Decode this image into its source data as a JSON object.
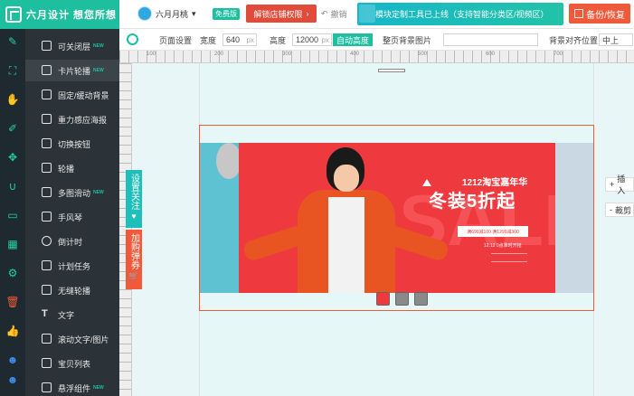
{
  "header": {
    "logo_text": "六月设计 想您所想",
    "username": "六月月桃",
    "free_badge": "免费版",
    "unlock_label": "解锁店铺权限",
    "undo_label": "撤销",
    "announcement": "模块定制工具已上线（支持智能分类区/视频区）",
    "backup_label": "备份/恢复"
  },
  "iconbar": {
    "icons": [
      "edit-icon",
      "crop-icon",
      "hand-icon",
      "pen-icon",
      "layout-icon",
      "magnet-icon",
      "ruler-icon",
      "grid-icon",
      "gear-icon",
      "trash-icon",
      "like-icon",
      "face-icon",
      "face-icon"
    ]
  },
  "sidemenu": {
    "items": [
      {
        "label": "可关闭层",
        "new": "NEW"
      },
      {
        "label": "卡片轮播",
        "new": "NEW"
      },
      {
        "label": "固定/缓动背景",
        "new": ""
      },
      {
        "label": "重力感应海报",
        "new": ""
      },
      {
        "label": "切换按钮",
        "new": ""
      },
      {
        "label": "轮播",
        "new": ""
      },
      {
        "label": "多图滑动",
        "new": "NEW"
      },
      {
        "label": "手风琴",
        "new": ""
      },
      {
        "label": "倒计时",
        "new": ""
      },
      {
        "label": "计划任务",
        "new": ""
      },
      {
        "label": "无缝轮播",
        "new": ""
      },
      {
        "label": "文字",
        "new": ""
      },
      {
        "label": "滚动文字/图片",
        "new": ""
      },
      {
        "label": "宝贝列表",
        "new": ""
      },
      {
        "label": "悬浮组件",
        "new": "NEW"
      }
    ],
    "text_icon": "T"
  },
  "toolbar": {
    "page_settings": "页面设置",
    "width_label": "宽度",
    "width_value": "640",
    "width_unit": "px",
    "height_label": "高度",
    "height_value": "12000",
    "height_unit": "px",
    "auto_height": "自动高度",
    "bg_image_label": "整页背景图片",
    "bg_align_label": "背景对齐位置",
    "bg_align_value": "中上"
  },
  "ruler": {
    "ticks": [
      "100",
      "200",
      "300",
      "400",
      "500",
      "600",
      "700"
    ]
  },
  "canvas": {
    "slide": {
      "event": "1212淘宝嘉年华",
      "headline": "冬装5折起",
      "coupon": "满699减100 满1299减300",
      "date": "12.12 0点准时开抢",
      "shirt_text": "HEART LIKE TAINI",
      "ghost_letter": "SALE"
    },
    "dots_count": 3,
    "active_dot": 0
  },
  "float_panels": {
    "follow": "设置关注",
    "cart": "加购弹券",
    "follow_icon": "♥",
    "cart_icon": "🛒"
  },
  "side_actions": {
    "insert": "插入",
    "crop": "裁剪",
    "insert_prefix": "+",
    "crop_prefix": "-"
  }
}
